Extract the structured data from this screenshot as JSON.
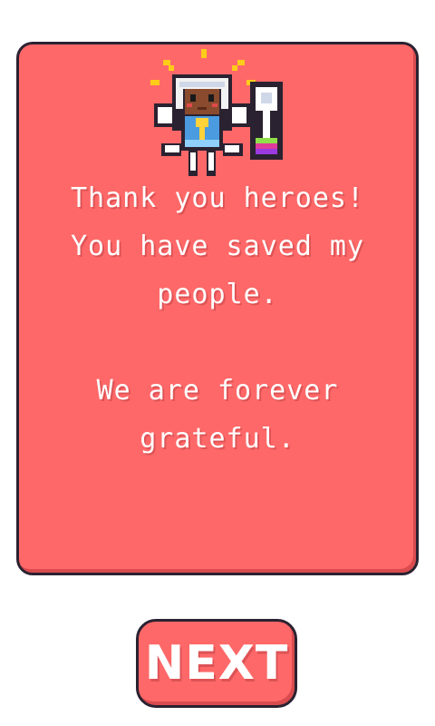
{
  "dialog": {
    "line1": "Thank you heroes!\nYou have saved my\npeople.",
    "line2": "We are forever\ngrateful."
  },
  "next_button": {
    "label": "NEXT"
  },
  "sprite": {
    "character_icon": "hero-princess-icon",
    "item_icon": "magic-key-icon",
    "sparkle_icon": "sparkle-icon"
  }
}
